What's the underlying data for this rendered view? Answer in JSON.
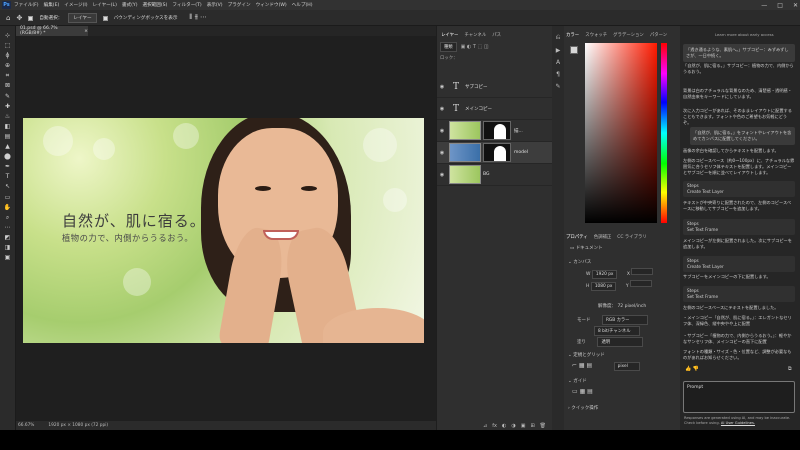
{
  "menu": {
    "logo": "Ps",
    "items": [
      "ファイル(F)",
      "編集(E)",
      "イメージ(I)",
      "レイヤー(L)",
      "書式(Y)",
      "選択範囲(S)",
      "フィルター(T)",
      "表示(V)",
      "プラグイン",
      "ウィンドウ(W)",
      "ヘルプ(H)"
    ]
  },
  "window_controls": [
    "—",
    "□",
    "✕"
  ],
  "options_bar": {
    "auto_select_label": "自動選択：",
    "auto_select_target": "レイヤー",
    "bounding_box_label": "バウンディングボックスを表示"
  },
  "document_tab": {
    "title": "01.psd @ 66.7% (RGB/8#) *",
    "close": "×"
  },
  "toolbar_icons": [
    "⊹",
    "⬚",
    "ϕ",
    "⊕",
    "⌗",
    "⊠",
    "✎",
    "✚",
    "♨",
    "◧",
    "▤",
    "▲",
    "⬤",
    "✒",
    "T",
    "↖",
    "▭",
    "✋",
    "⌕",
    "⋯",
    "◩",
    "◨",
    "▣"
  ],
  "canvas": {
    "headline": "自然が、肌に宿る。",
    "subline": "植物の力で、内側からうるおう。"
  },
  "status_bar": {
    "zoom": "66.67%",
    "doc_size": "1920 px × 1080 px (72 ppi)"
  },
  "layers_panel": {
    "tabs": [
      "レイヤー",
      "チャンネル",
      "パス"
    ],
    "filter_label": "種類",
    "lock_label": "ロック：",
    "layers": [
      {
        "type": "text",
        "name": "サブコピー",
        "visible": true
      },
      {
        "type": "text",
        "name": "メインコピー",
        "visible": true
      },
      {
        "type": "image-mask",
        "name": "描...",
        "visible": true
      },
      {
        "type": "image-mask",
        "name": "model",
        "visible": true
      },
      {
        "type": "image",
        "name": "BG",
        "visible": true
      }
    ],
    "footer_icons": [
      "⊿",
      "fx",
      "◐",
      "◑",
      "▣",
      "⊞",
      "🗑"
    ]
  },
  "color_panel": {
    "tabs": [
      "カラー",
      "スウォッチ",
      "グラデーション",
      "パターン"
    ]
  },
  "properties_panel": {
    "tabs": [
      "プロパティ",
      "色調補正",
      "CC ライブラリ"
    ],
    "doc_label": "ドキュメント",
    "canvas_section": "カンバス",
    "width_label": "W",
    "width_value": "1920 px",
    "x_label": "X",
    "height_label": "H",
    "height_value": "1080 px",
    "y_label": "Y",
    "resolution_label": "解像度：",
    "resolution_value": "72 pixel/inch",
    "mode_label": "モード",
    "mode_value": "RGB カラー",
    "depth_value": "8 bit/チャンネル",
    "fill_label": "塗り",
    "fill_value": "透明",
    "rulers_section": "定規とグリッド",
    "unit_value": "pixel",
    "guides_section": "ガイド",
    "quick_actions_section": "クイック操作"
  },
  "assistant": {
    "banner": "Learn more about early access",
    "quote_1": "「透き通るような、素肌へ。」サブコピー：みずみずしさが、一日中続く。",
    "quote_2": "「自然が、肌に宿る。」サブコピー：植物の力で、内側からうるおう。",
    "para_1": "背景は白のナチュラルな背景なのため、清楚感・透明感・自然由来をキーワードにしています。",
    "para_2": "次に入力コピーがあれば、そのままレイアウトに配置することもできます。フォントや色のご希望もお気軽にどうぞ。",
    "quote_3": "「自然が、肌に宿る。」をフォントやレイアウトを含めてカンバスに配置してください。",
    "para_3": "画像の余白を確認してからテキストを配置します。",
    "para_4": "左側のコピースペース（約0〜100px）に、ナチュラルな雰囲気に合うセリフ体テキストを配置します。メインコピーとサブコピーを順に並べてレイアウトします。",
    "step_1_title": "Steps",
    "step_1_item": "Create Text Layer",
    "para_5": "テキストが中央寄りに配置されたので、左側のコピースペースに移動してサブコピーを追加します。",
    "step_2_title": "Steps",
    "step_2_item": "Set Text Frame",
    "para_6": "メインコピーが左側に配置されました。次にサブコピーを追加します。",
    "step_3_title": "Steps",
    "step_3_item": "Create Text Layer",
    "para_7": "サブコピーをメインコピーの下に配置します。",
    "step_4_title": "Steps",
    "step_4_item": "Set Text Frame",
    "para_8": "左側のコピースペースにテキストを配置しました。",
    "bullet_1": "・メインコピー「自然が、肌に宿る。」：エレガントなセリフ体、深緑色、縦中央やや上に配置",
    "bullet_2": "・サブコピー「植物の力で、内側からうるおう。」：軽やかなサンセリフ体、メインコピーの直下に配置",
    "para_9": "フォントの種類・サイズ・色・位置など、調整が必要なものがあればお知らせください。",
    "prompt_placeholder": "Prompt",
    "disclaimer": "Responses are generated using AI, and may be inaccurate. Check before using.",
    "guidelines_link": "AI User Guidelines."
  }
}
